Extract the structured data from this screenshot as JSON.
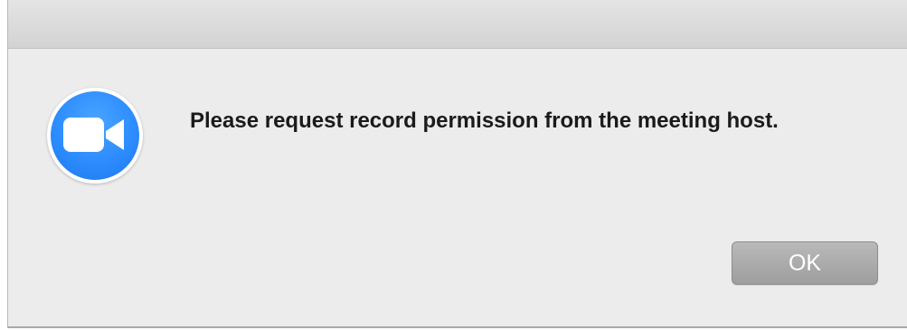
{
  "dialog": {
    "message": "Please request record permission from the meeting host.",
    "ok_label": "OK",
    "icon": "video-camera-icon"
  },
  "colors": {
    "icon_blue": "#2d8cff",
    "dialog_background": "#ececec",
    "button_background": "#a8a8a8"
  }
}
